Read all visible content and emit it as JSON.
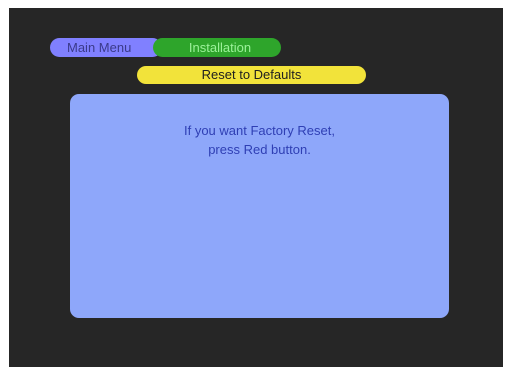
{
  "breadcrumb": {
    "main_menu": "Main Menu",
    "installation": "Installation"
  },
  "page_title": "Reset to Defaults",
  "dialog": {
    "line1": "If you want Factory Reset,",
    "line2": "press Red button."
  },
  "colors": {
    "screen_background": "#262626",
    "main_menu_pill": "#8080ff",
    "installation_pill": "#2ea52b",
    "title_pill": "#f2e33a",
    "dialog_background": "#8ea7fa",
    "dialog_text": "#2f3fb4"
  }
}
